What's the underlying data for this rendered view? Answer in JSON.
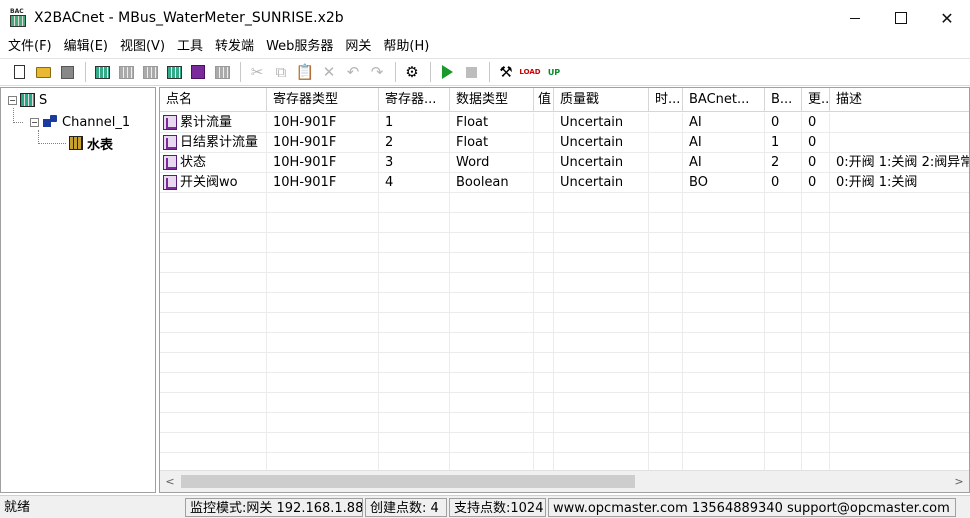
{
  "window": {
    "app_icon_text": "BAC",
    "title": "X2BACnet - MBus_WaterMeter_SUNRISE.x2b",
    "close_glyph": "✕"
  },
  "menu": [
    "文件(F)",
    "编辑(E)",
    "视图(V)",
    "工具",
    "转发端",
    "Web服务器",
    "网关",
    "帮助(H)"
  ],
  "toolbar": {
    "cut": "✂",
    "copy": "⧉",
    "paste": "📋",
    "delete": "✕",
    "undo": "↶",
    "redo": "↷",
    "build": "⚙",
    "tools": "⚒",
    "load": "LOAD",
    "up": "UP"
  },
  "tree": {
    "root": {
      "label": "S",
      "expander": "−"
    },
    "channel": {
      "label": "Channel_1",
      "expander": "−"
    },
    "device": {
      "label": "水表"
    }
  },
  "table": {
    "columns": [
      "点名",
      "寄存器类型",
      "寄存器...",
      "数据类型",
      "值",
      "质量戳",
      "时...",
      "BACnet...",
      "B...",
      "更...",
      "描述"
    ],
    "rows": [
      [
        "累计流量",
        "10H-901F",
        "1",
        "Float",
        "",
        "Uncertain",
        "",
        "AI",
        "0",
        "0",
        ""
      ],
      [
        "日结累计流量",
        "10H-901F",
        "2",
        "Float",
        "",
        "Uncertain",
        "",
        "AI",
        "1",
        "0",
        ""
      ],
      [
        "状态",
        "10H-901F",
        "3",
        "Word",
        "",
        "Uncertain",
        "",
        "AI",
        "2",
        "0",
        "0:开阀 1:关阀 2:阀异常"
      ],
      [
        "开关阀wo",
        "10H-901F",
        "4",
        "Boolean",
        "",
        "Uncertain",
        "",
        "BO",
        "0",
        "0",
        "0:开阀 1:关阀"
      ]
    ]
  },
  "scrollbar": {
    "left": "<",
    "right": ">"
  },
  "status": {
    "ready": "就绪",
    "mode": "监控模式:网关 192.168.1.88",
    "created": "创建点数: 4",
    "supported": "支持点数:1024",
    "contact": "www.opcmaster.com 13564889340 support@opcmaster.com"
  }
}
